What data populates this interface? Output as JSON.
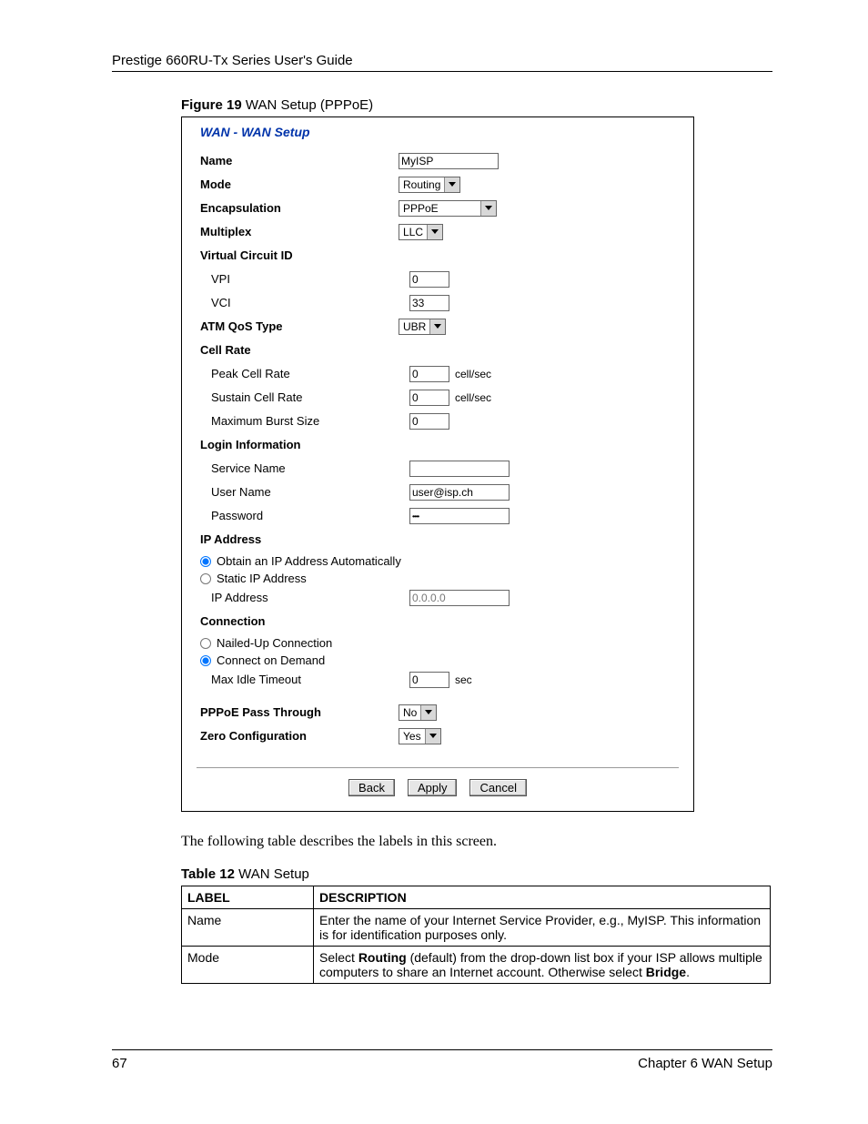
{
  "header": {
    "doc_title": "Prestige 660RU-Tx Series User's Guide"
  },
  "figure": {
    "caption_bold": "Figure 19",
    "caption_rest": "   WAN Setup (PPPoE)"
  },
  "panel": {
    "title": "WAN - WAN Setup",
    "name": {
      "label": "Name",
      "value": "MyISP"
    },
    "mode": {
      "label": "Mode",
      "value": "Routing"
    },
    "encap": {
      "label": "Encapsulation",
      "value": "PPPoE"
    },
    "mux": {
      "label": "Multiplex",
      "value": "LLC"
    },
    "vcid": {
      "label": "Virtual Circuit ID"
    },
    "vpi": {
      "label": "VPI",
      "value": "0"
    },
    "vci": {
      "label": "VCI",
      "value": "33"
    },
    "qos": {
      "label": "ATM QoS Type",
      "value": "UBR"
    },
    "cellrate": {
      "label": "Cell Rate"
    },
    "pcr": {
      "label": "Peak Cell Rate",
      "value": "0",
      "unit": "cell/sec"
    },
    "scr": {
      "label": "Sustain Cell Rate",
      "value": "0",
      "unit": "cell/sec"
    },
    "mbs": {
      "label": "Maximum Burst Size",
      "value": "0"
    },
    "login": {
      "label": "Login Information"
    },
    "svc": {
      "label": "Service Name",
      "value": ""
    },
    "user": {
      "label": "User Name",
      "value": "user@isp.ch"
    },
    "pass": {
      "label": "Password",
      "value": "••••"
    },
    "ipaddr": {
      "label": "IP Address"
    },
    "ip_auto": "Obtain an IP Address Automatically",
    "ip_static": "Static IP Address",
    "ip_field": {
      "label": "IP Address",
      "value": "0.0.0.0"
    },
    "conn": {
      "label": "Connection"
    },
    "nailed": "Nailed-Up Connection",
    "ondemand": "Connect on Demand",
    "idle": {
      "label": "Max Idle Timeout",
      "value": "0",
      "unit": "sec"
    },
    "ppass": {
      "label": "PPPoE Pass Through",
      "value": "No"
    },
    "zero": {
      "label": "Zero Configuration",
      "value": "Yes"
    },
    "buttons": {
      "back": "Back",
      "apply": "Apply",
      "cancel": "Cancel"
    }
  },
  "body_para": "The following table describes the labels in this screen.",
  "table": {
    "caption_bold": "Table 12",
    "caption_rest": "   WAN Setup",
    "head": {
      "c1": "LABEL",
      "c2": "DESCRIPTION"
    },
    "rows": [
      {
        "c1": "Name",
        "c2": "Enter the name of your Internet Service Provider, e.g., MyISP. This information is for identification purposes only."
      },
      {
        "c1": "Mode",
        "c2_pre": "Select ",
        "c2_b1": "Routing",
        "c2_mid": " (default) from the drop-down list box if your ISP allows multiple computers to share an Internet account. Otherwise select ",
        "c2_b2": "Bridge",
        "c2_post": "."
      }
    ]
  },
  "footer": {
    "page": "67",
    "chapter": "Chapter 6 WAN Setup"
  }
}
